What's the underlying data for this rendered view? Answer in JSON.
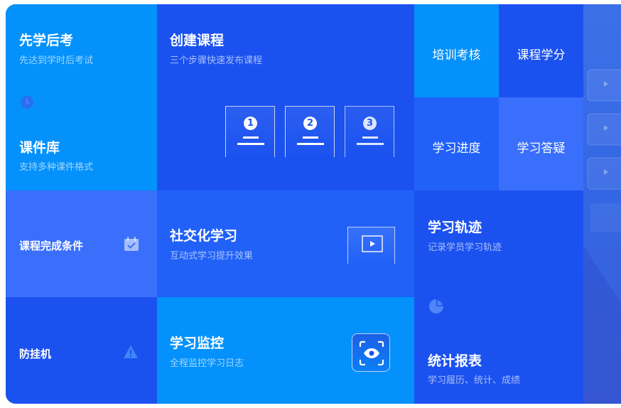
{
  "tiles": {
    "study_then_exam": {
      "title": "先学后考",
      "subtitle": "先达到学时后考试"
    },
    "courseware": {
      "title": "课件库",
      "subtitle": "支持多种课件格式"
    },
    "create_course": {
      "title": "创建课程",
      "subtitle": "三个步骤快速发布课程",
      "steps": [
        "1",
        "2",
        "3"
      ]
    },
    "training_exam": {
      "label": "培训考核"
    },
    "course_credit": {
      "label": "课程学分"
    },
    "learning_progress": {
      "label": "学习进度"
    },
    "learning_qa": {
      "label": "学习答疑"
    },
    "completion_conditions": {
      "label": "课程完成条件"
    },
    "social_learning": {
      "title": "社交化学习",
      "subtitle": "互动式学习提升效果"
    },
    "learning_track": {
      "title": "学习轨迹",
      "subtitle": "记录学员学习轨迹"
    },
    "anti_hang": {
      "label": "防挂机"
    },
    "learning_monitor": {
      "title": "学习监控",
      "subtitle": "全程监控学习日志"
    },
    "statistics": {
      "title": "统计报表",
      "subtitle": "学习履历、统计、成绩"
    }
  },
  "colors": {
    "sky": "#0491fb",
    "royal": "#1b52ef",
    "medium": "#2161f8",
    "light": "#3a6ffc",
    "white": "#ffffff"
  },
  "icons": [
    "clock-icon",
    "calendar-check-icon",
    "warning-icon",
    "play-icon",
    "eye-icon",
    "pie-chart-icon"
  ]
}
